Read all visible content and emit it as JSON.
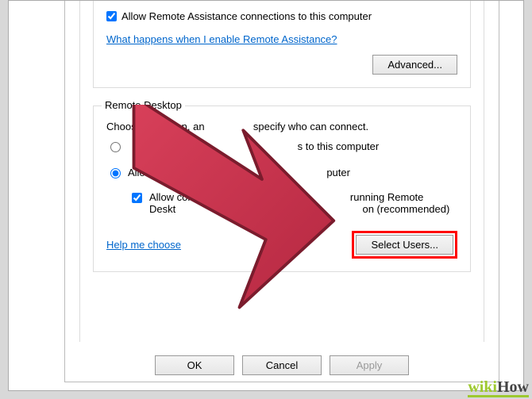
{
  "remote_assistance": {
    "allow_label": "Allow Remote Assistance connections to this computer",
    "allow_checked": true,
    "help_link": "What happens when I enable Remote Assistance?",
    "advanced_button": "Advanced..."
  },
  "remote_desktop": {
    "legend": "Remote Desktop",
    "intro_prefix": "Choose an option, an",
    "intro_suffix": "specify who can connect.",
    "option_dont_allow_prefix": "",
    "option_dont_allow_suffix": "s to this computer",
    "option_dont_allow_selected": false,
    "option_allow_prefix": "Allow",
    "option_allow_suffix": "puter",
    "option_allow_selected": true,
    "nla_prefix_line1": "Allow con",
    "nla_suffix_line1": "running Remote",
    "nla_prefix_line2": "Deskt",
    "nla_suffix_line2": "on (recommended)",
    "nla_checked": true,
    "help_link": "Help me choose",
    "select_users_button": "Select Users..."
  },
  "dialog_buttons": {
    "ok": "OK",
    "cancel": "Cancel",
    "apply": "Apply"
  },
  "watermark": {
    "wiki": "wiki",
    "how": "How"
  },
  "annotation": {
    "arrow_color": "#c83349"
  }
}
